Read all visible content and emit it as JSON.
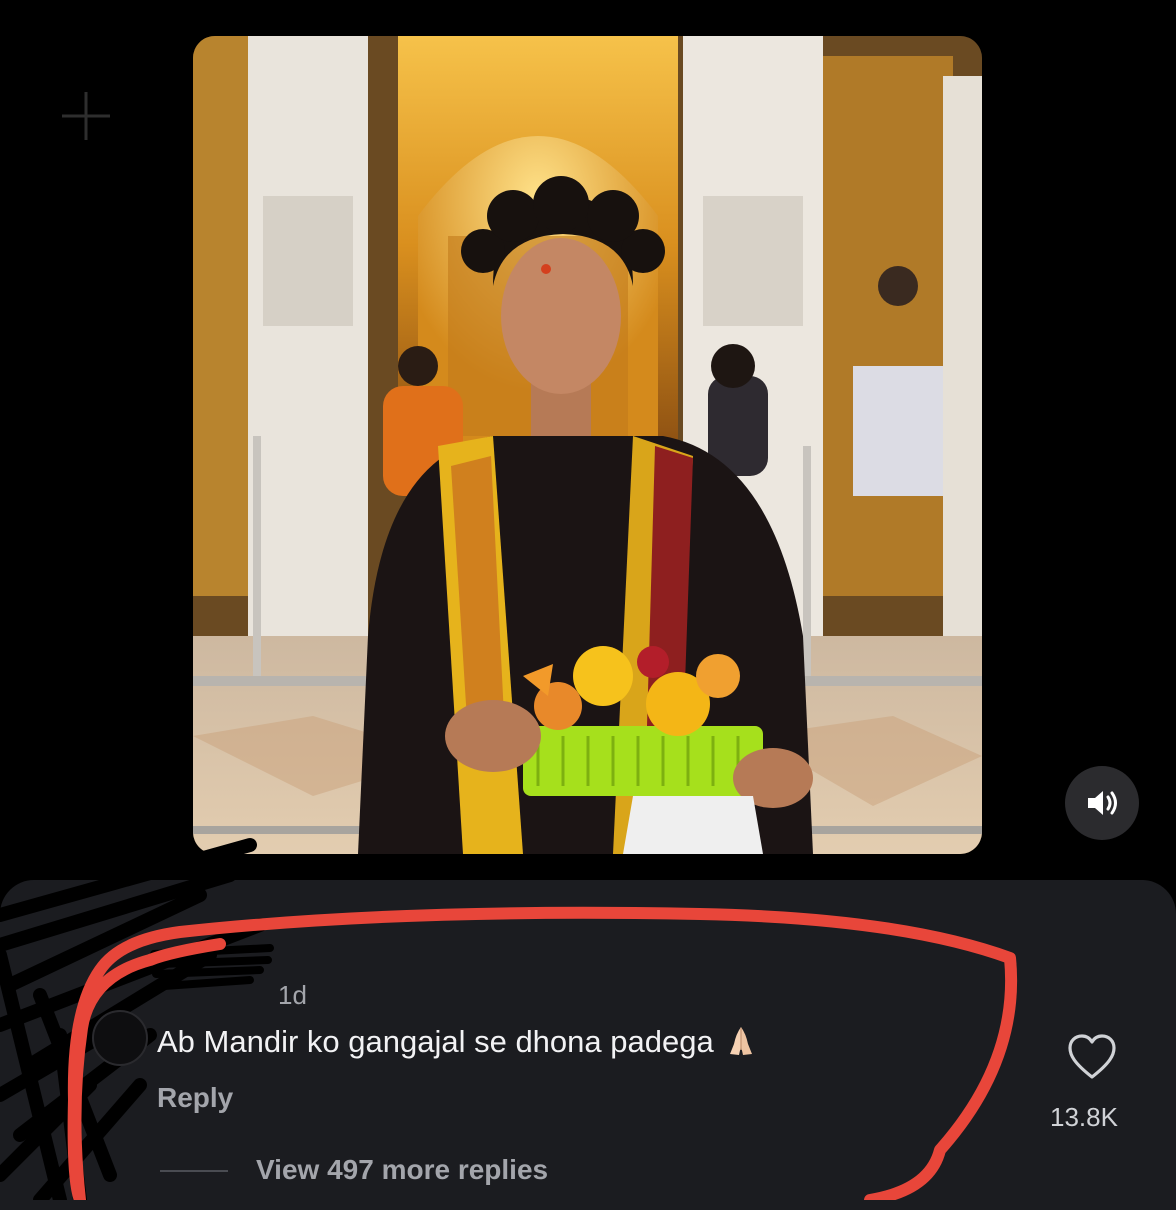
{
  "comment": {
    "username": "",
    "time_ago": "1d",
    "text": "Ab Mandir ko gangajal se dhona padega",
    "emoji": "🙏🏻",
    "reply_label": "Reply",
    "like_count": "13.8K",
    "view_replies_label": "View 497 more replies"
  },
  "media": {
    "icon": "speaker-unmuted-icon"
  },
  "colors": {
    "background": "#000000",
    "sheet": "#1b1c20",
    "annotation": "#e8463a",
    "secondary_text": "#a3a5ab",
    "primary_text": "#f2f2f4"
  }
}
